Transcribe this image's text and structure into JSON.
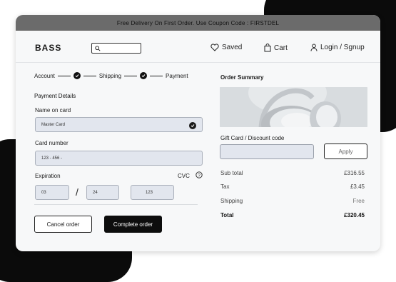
{
  "promo": {
    "text": "Free Delivery On First Order. Use Coupon Code : FIRSTDEL"
  },
  "header": {
    "logo": "BASS",
    "search": {
      "value": "",
      "placeholder": ""
    },
    "saved_label": "Saved",
    "cart_label": "Cart",
    "account_label": "Login / Sgnup"
  },
  "steps": [
    "Account",
    "Shipping",
    "Payment"
  ],
  "payment": {
    "title": "Payment Details",
    "name_label": "Name on card",
    "name_value": "Master Card",
    "card_label": "Card number",
    "card_value": "123 - 456 -",
    "expiration_label": "Expiration",
    "cvc_label": "CVC",
    "exp_month": "03",
    "exp_separator": "/",
    "exp_year": "24",
    "cvc_value": "123"
  },
  "actions": {
    "cancel": "Cancel order",
    "complete": "Complete order"
  },
  "summary": {
    "title": "Order Summary",
    "gift_label": "Gift Card / Discount code",
    "apply_label": "Apply",
    "rows": [
      {
        "label": "Sub total",
        "value": "£316.55"
      },
      {
        "label": "Tax",
        "value": "£3.45"
      },
      {
        "label": "Shipping",
        "value": "Free"
      },
      {
        "label": "Total",
        "value": "£320.45"
      }
    ]
  },
  "colors": {
    "accent": "#0d0d0d",
    "field_bg": "#e2e6ee",
    "promo_bg": "#6b6b6b",
    "page_bg": "#f7f8f9"
  },
  "icons": [
    "search-icon",
    "heart-icon",
    "bag-icon",
    "user-icon",
    "check-icon",
    "help-circle-icon"
  ]
}
